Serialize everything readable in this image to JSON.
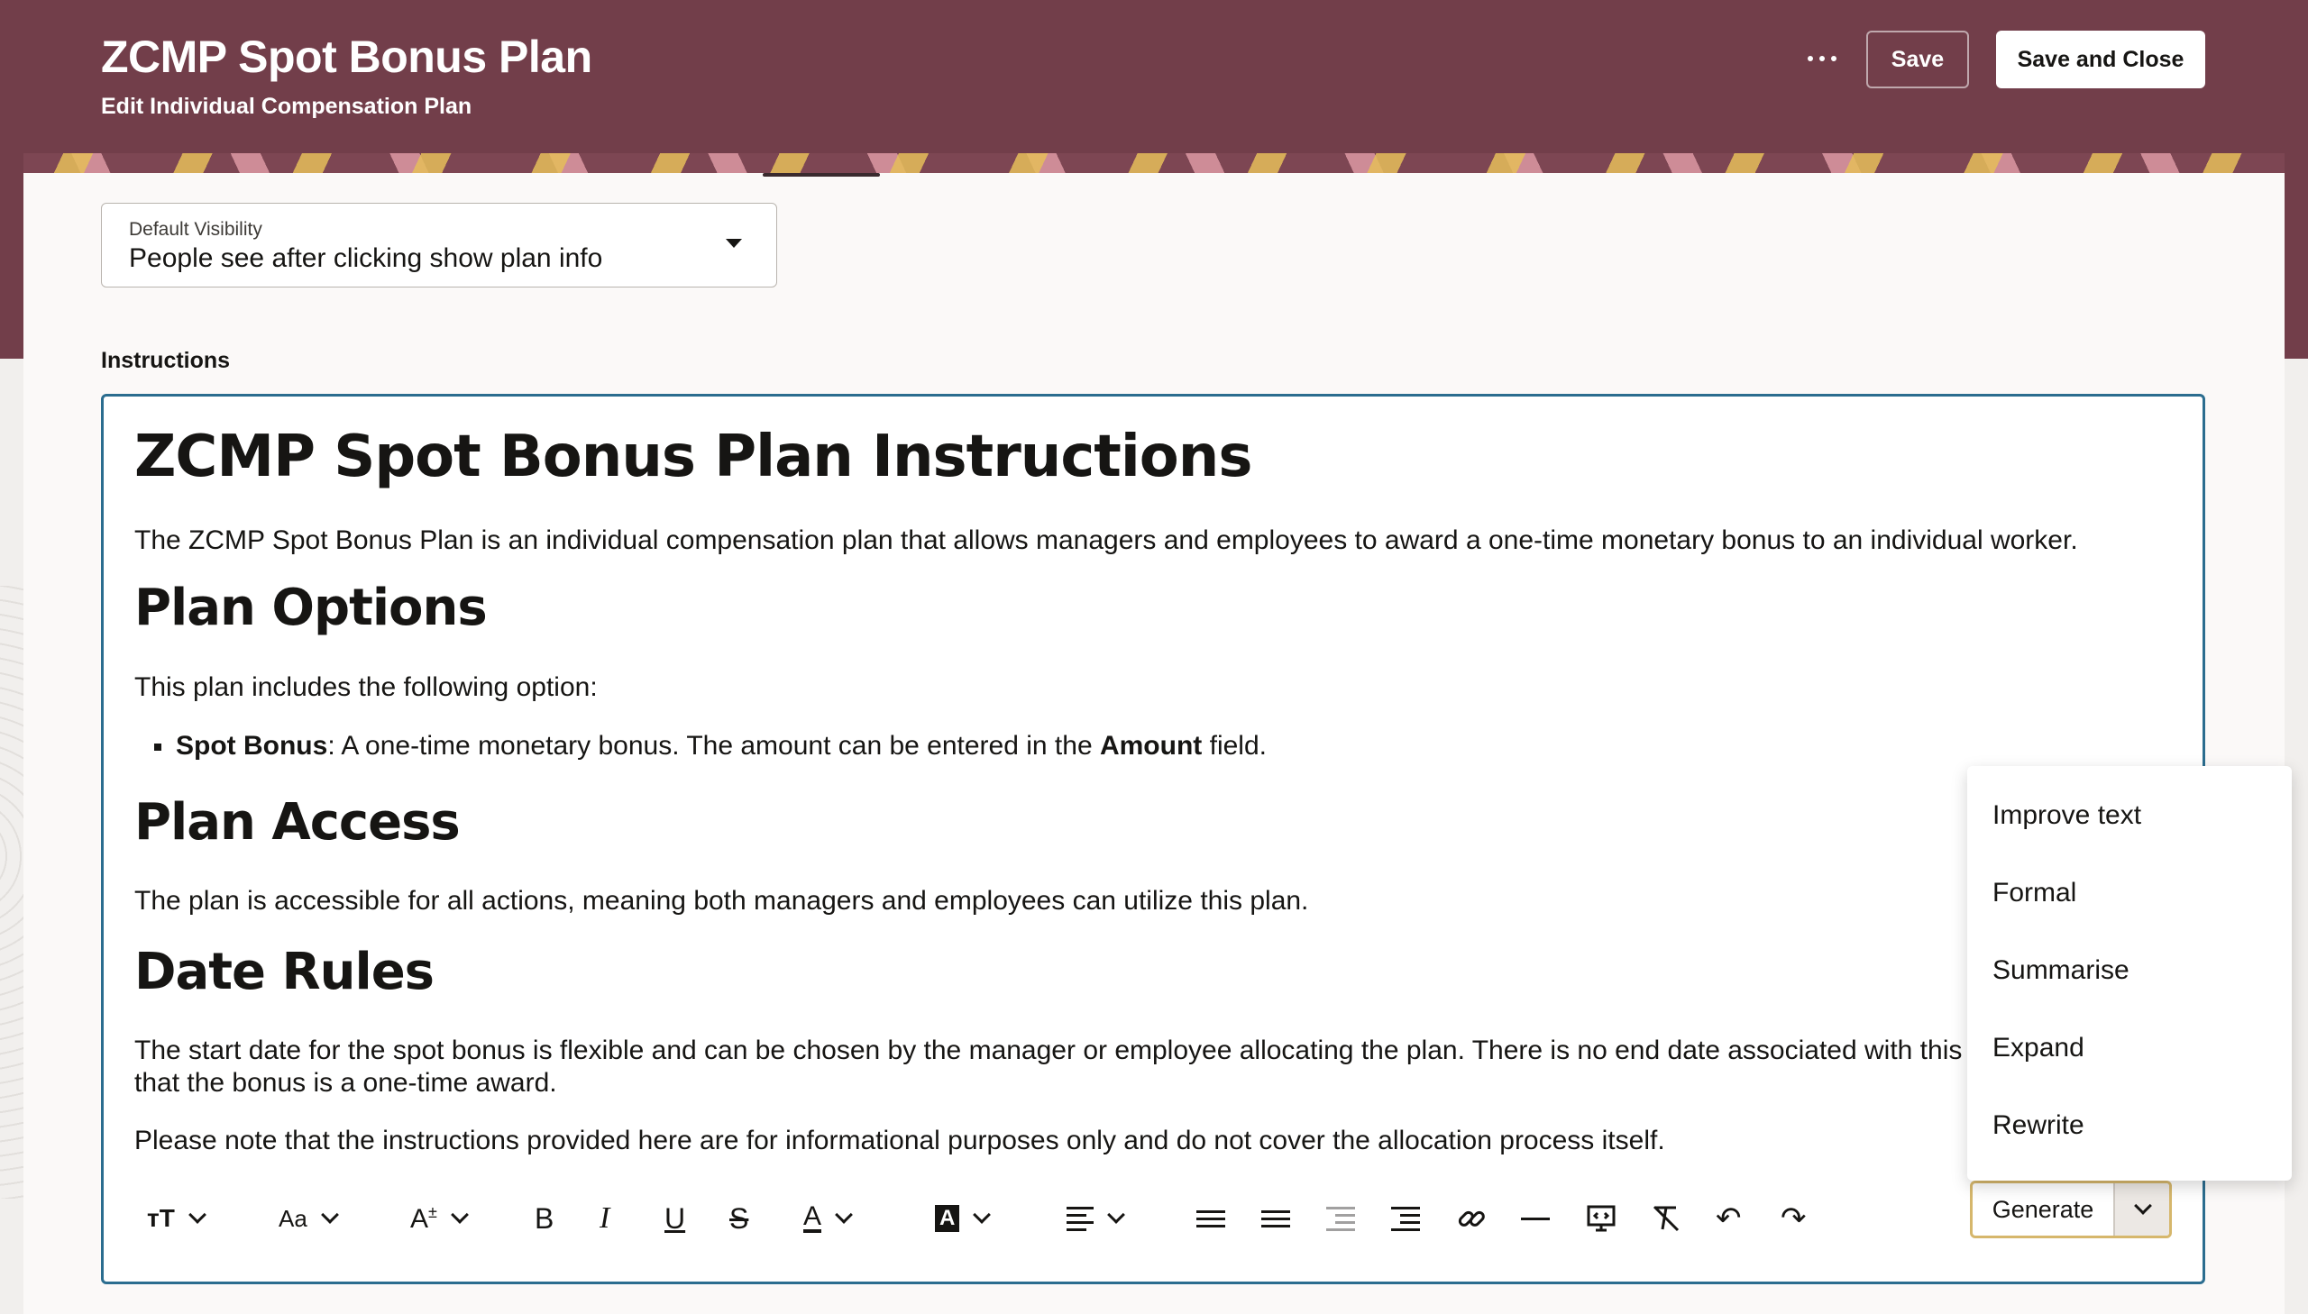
{
  "header": {
    "title": "ZCMP Spot Bonus Plan",
    "subtitle": "Edit Individual Compensation Plan",
    "save_label": "Save",
    "save_close_label": "Save and Close",
    "more_icon": "ellipsis-icon"
  },
  "visibility": {
    "label": "Default Visibility",
    "value": "People see after clicking show plan info"
  },
  "instructions": {
    "label": "Instructions",
    "heading": "ZCMP Spot Bonus Plan Instructions",
    "intro": "The ZCMP Spot Bonus Plan is an individual compensation plan that allows managers and employees to award a one-time monetary bonus to an individual worker.",
    "options_heading": "Plan Options",
    "options_text": "This plan includes the following option:",
    "bullet_term": "Spot Bonus",
    "bullet_text_1": ": A one-time monetary bonus. The amount can be entered in the ",
    "bullet_field": "Amount",
    "bullet_text_2": " field.",
    "access_heading": "Plan Access",
    "access_text": "The plan is accessible for all actions, meaning both managers and employees can utilize this plan.",
    "date_heading": "Date Rules",
    "date_text_1": "The start date for the spot bonus is flexible and can be chosen by the manager or employee allocating the plan. There is no end date associated with this optic",
    "date_text_2": "that the bonus is a one-time award.",
    "note_text": "Please note that the instructions provided here are for informational purposes only and do not cover the allocation process itself."
  },
  "toolbar": {
    "text_size_glyph": "тT",
    "font_glyph": "Aa",
    "superscript_glyph": "A",
    "superscript_mark": "±",
    "bold_glyph": "B",
    "italic_glyph": "I",
    "underline_glyph": "U",
    "strike_glyph": "S",
    "font_color_glyph": "A",
    "highlight_glyph": "A",
    "generate_label": "Generate",
    "undo_glyph": "↶",
    "redo_glyph": "↷"
  },
  "menu": {
    "items": [
      "Improve text",
      "Formal",
      "Summarise",
      "Expand",
      "Rewrite"
    ]
  },
  "colors": {
    "brand": "#723e4a",
    "editor_border": "#2b6d8f",
    "generate_border": "#d6b76c"
  }
}
